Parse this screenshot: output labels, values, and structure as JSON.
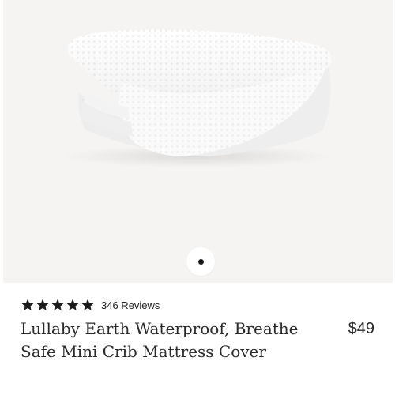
{
  "product": {
    "title": "Lullaby Earth Waterproof, Breathe Safe Mini Crib Mattress Cover",
    "price": "$49",
    "rating": 5,
    "rating_max": 5,
    "reviews_label": "346 Reviews"
  },
  "carousel": {
    "current": 1,
    "total": 1
  },
  "colors": {
    "image_background": "#f6f4f2",
    "text": "#2a2a2a",
    "star": "#1c1c1c"
  },
  "icons": [
    "star-icon",
    "carousel-dot-icon"
  ]
}
